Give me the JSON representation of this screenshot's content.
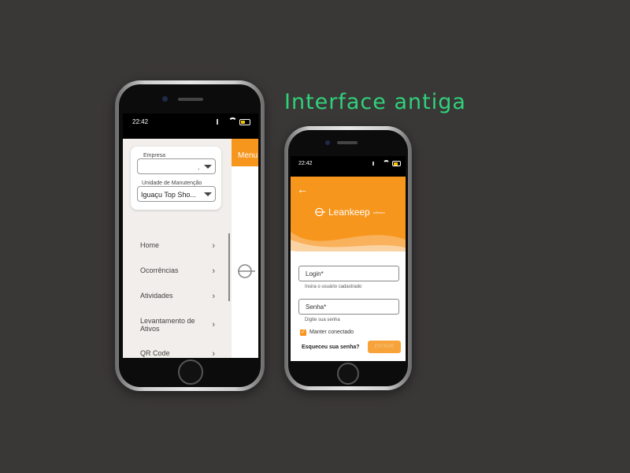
{
  "headline": "Interface antiga",
  "phone_left": {
    "status_time": "22:42",
    "company_label": "Empresa",
    "company_value": ".",
    "unit_label": "Unidade de Manutenção",
    "unit_value": "Iguaçu Top Sho...",
    "menu_header": "Menu",
    "menu_items": [
      {
        "label": "Home"
      },
      {
        "label": "Ocorrências"
      },
      {
        "label": "Atividades"
      },
      {
        "label": "Levantamento de Ativos"
      },
      {
        "label": "QR Code"
      }
    ],
    "chevron": "›"
  },
  "phone_right": {
    "status_time": "22:42",
    "back_icon": "←",
    "brand": "Leankeep",
    "brand_sub": "software",
    "login_placeholder": "Login*",
    "login_hint": "Insira o usuário cadastrado",
    "password_placeholder": "Senha*",
    "password_hint": "Digite sua senha",
    "keep_connected": "Manter conectado",
    "forgot": "Esqueceu sua senha?",
    "enter": "ENTRAR"
  },
  "colors": {
    "orange": "#f7961d",
    "headline": "#2fd27a",
    "background": "#3a3737"
  }
}
